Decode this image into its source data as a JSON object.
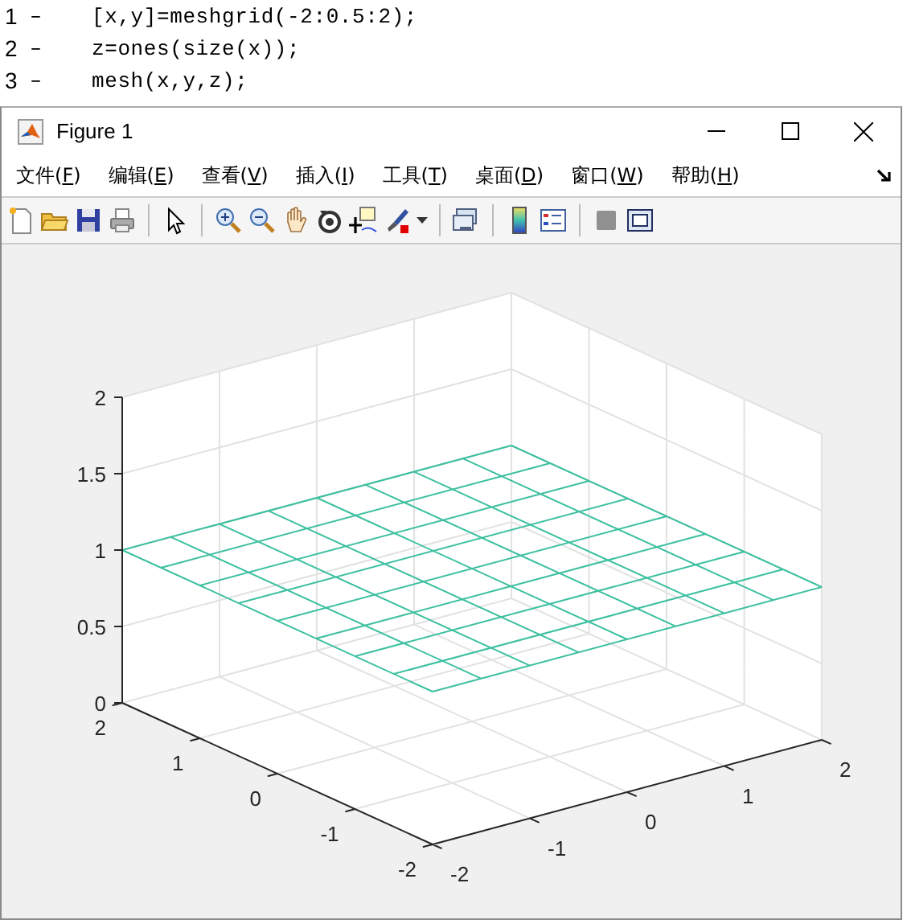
{
  "editor": {
    "lines": [
      {
        "number": "1",
        "marker": "–",
        "code": "[x,y]=meshgrid(-2:0.5:2);"
      },
      {
        "number": "2",
        "marker": "–",
        "code": "z=ones(size(x));"
      },
      {
        "number": "3",
        "marker": "–",
        "code": "mesh(x,y,z);"
      }
    ]
  },
  "window": {
    "title": "Figure 1"
  },
  "menu": [
    {
      "label": "文件(F)"
    },
    {
      "label": "编辑(E)"
    },
    {
      "label": "查看(V)"
    },
    {
      "label": "插入(I)"
    },
    {
      "label": "工具(T)"
    },
    {
      "label": "桌面(D)"
    },
    {
      "label": "窗口(W)"
    },
    {
      "label": "帮助(H)"
    }
  ],
  "plot": {
    "z_ticks": [
      "2",
      "1.5",
      "1",
      "0.5",
      "0"
    ],
    "y_ticks": [
      "-2",
      "-1",
      "0",
      "1",
      "2"
    ],
    "x_ticks": [
      "-2",
      "-1",
      "0",
      "1",
      "2"
    ]
  }
}
